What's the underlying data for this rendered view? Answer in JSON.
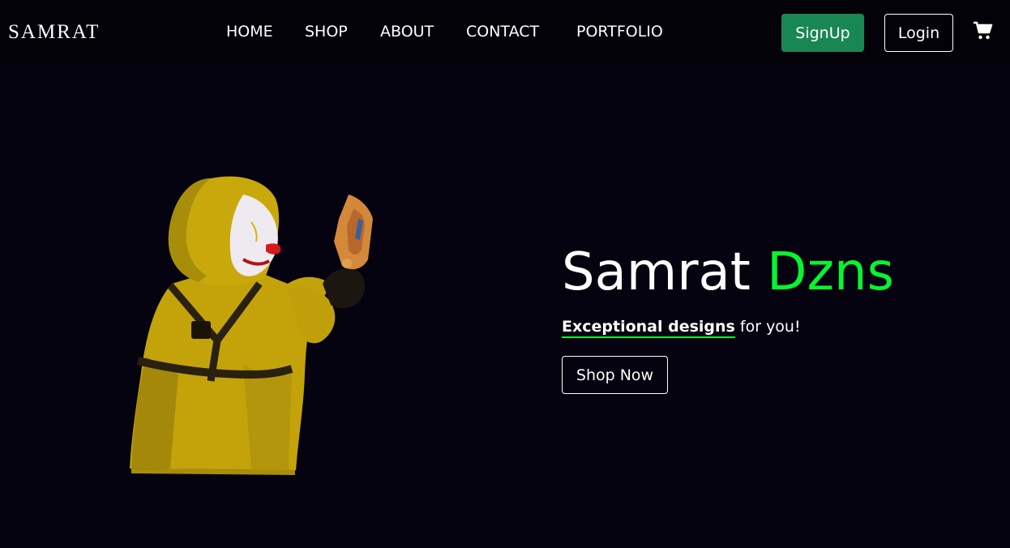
{
  "navbar": {
    "brand": "SAMRAT",
    "links": [
      "HOME",
      "SHOP",
      "ABOUT",
      "CONTACT",
      "PORTFOLIO"
    ],
    "signup_label": "SignUp",
    "login_label": "Login",
    "cart_icon": "cart-icon"
  },
  "hero": {
    "title_main": "Samrat",
    "title_accent": "Dzns",
    "subtitle_emphasis": "Exceptional designs",
    "subtitle_rest": " for you!",
    "cta_label": "Shop Now",
    "image": "hooded-clown-character-with-blaster"
  },
  "colors": {
    "background": "#04030f",
    "navbar": "#020208",
    "accent_green": "#06f52f",
    "signup_green": "#198754",
    "character_yellow": "#c9a80a"
  }
}
